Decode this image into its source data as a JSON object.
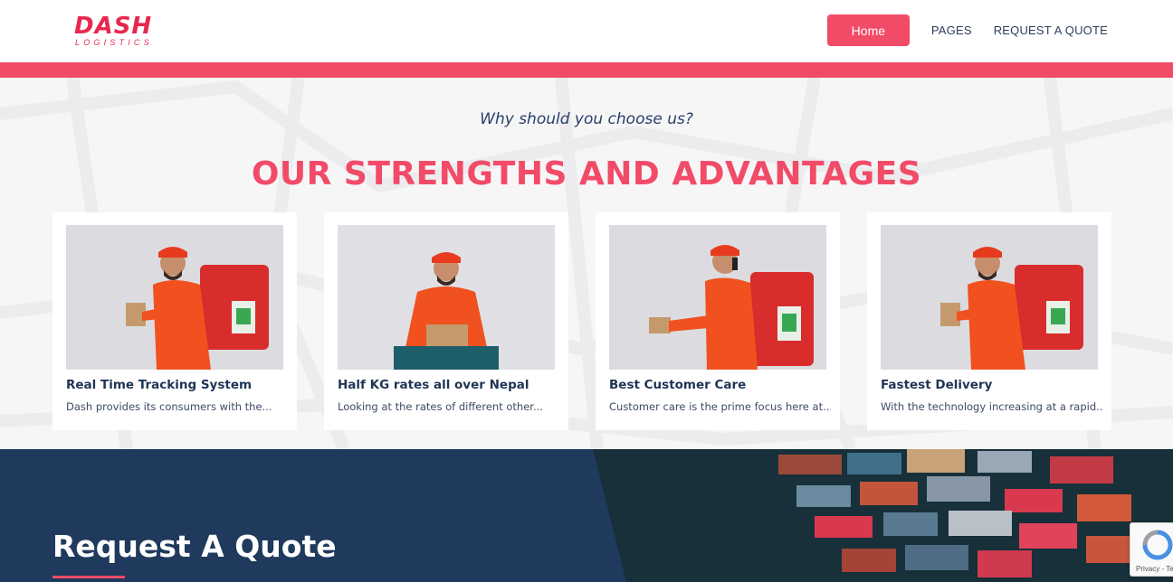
{
  "header": {
    "logo_word": "DASH",
    "logo_sub": "LOGISTICS",
    "nav": [
      {
        "label": "Home",
        "active": true
      },
      {
        "label": "PAGES"
      },
      {
        "label": "REQUEST A QUOTE"
      }
    ]
  },
  "strengths": {
    "eyebrow": "Why should you choose us?",
    "headline": "OUR STRENGTHS AND ADVANTAGES",
    "cards": [
      {
        "title": "Real Time Tracking System",
        "text": "Dash provides its consumers with the..."
      },
      {
        "title": "Half KG rates all over Nepal",
        "text": "Looking at the rates of different other..."
      },
      {
        "title": "Best Customer Care",
        "text": "Customer care is the prime focus here at..."
      },
      {
        "title": "Fastest Delivery",
        "text": "With the technology increasing at a rapid..."
      }
    ]
  },
  "quote": {
    "title": "Request A Quote"
  },
  "recaptcha": {
    "text": "Privacy - Te"
  },
  "colors": {
    "accent": "#f14b68",
    "navy": "#1f3a5c",
    "uniform": "#f0511f"
  }
}
